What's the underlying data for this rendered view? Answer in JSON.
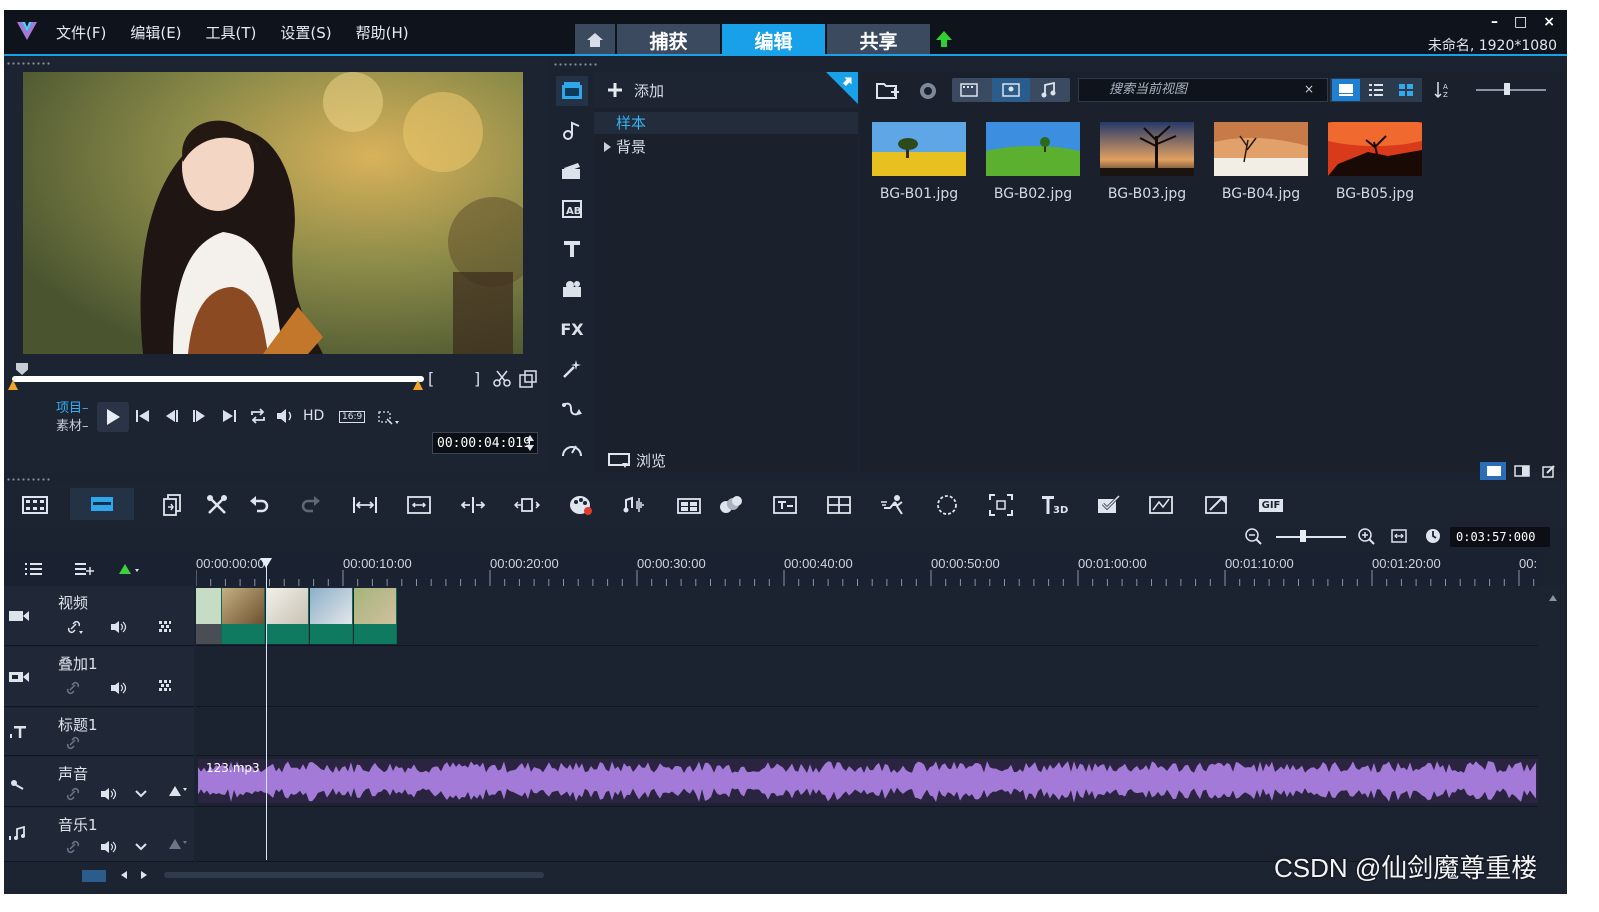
{
  "app": {
    "menu": [
      "文件(F)",
      "编辑(E)",
      "工具(T)",
      "设置(S)",
      "帮助(H)"
    ],
    "mode_tabs": [
      "捕获",
      "编辑",
      "共享"
    ],
    "active_tab": "编辑",
    "window_controls": [
      "–",
      "□",
      "×"
    ],
    "project_info": "未命名, 1920*1080",
    "accent_color": "#18a1e8"
  },
  "preview": {
    "project_label": "项目–",
    "clip_label": "素材–",
    "hd_label": "HD",
    "aspect_label": "16:9",
    "bracket_in": "[",
    "bracket_out": "]",
    "timecode": "00:00:04:019"
  },
  "library": {
    "add_label": "添加",
    "tree": [
      "样本",
      "背景"
    ],
    "selected_tree": "样本",
    "browse_label": "浏览",
    "search_placeholder": "搜索当前视图",
    "search_clear": "×",
    "thumbnails": [
      {
        "name": "BG-B01.jpg"
      },
      {
        "name": "BG-B02.jpg"
      },
      {
        "name": "BG-B03.jpg"
      },
      {
        "name": "BG-B04.jpg"
      },
      {
        "name": "BG-B05.jpg"
      }
    ]
  },
  "timeline": {
    "timecode": "0:03:57:000",
    "ruler_labels": [
      "00:00:00:00",
      "00:00:10:00",
      "00:00:20:00",
      "00:00:30:00",
      "00:00:40:00",
      "00:00:50:00",
      "00:01:00:00",
      "00:01:10:00",
      "00:01:20:00",
      "00:"
    ],
    "tracks": [
      {
        "name": "视频"
      },
      {
        "name": "叠加1"
      },
      {
        "name": "标题1"
      },
      {
        "name": "声音"
      },
      {
        "name": "音乐1"
      }
    ],
    "audio_clip": "123.mp3",
    "fx_label": "FX",
    "gif_label": "GIF"
  },
  "watermark": "CSDN @仙剑魔尊重楼"
}
